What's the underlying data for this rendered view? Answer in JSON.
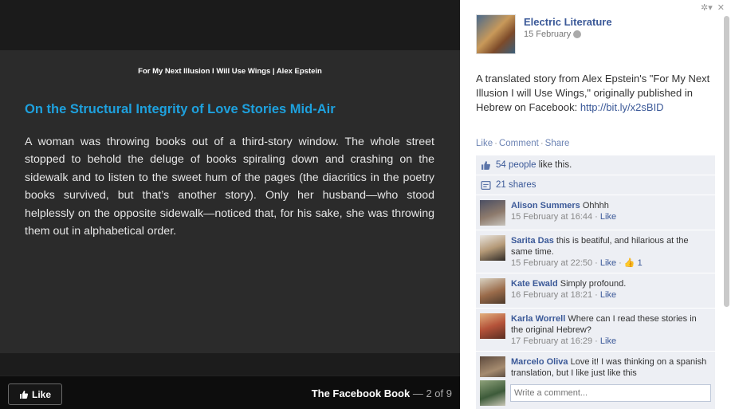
{
  "photo": {
    "header": "For My Next Illusion I Will Use Wings | Alex Epstein",
    "title": "On the Structural Integrity of Love Stories Mid-Air",
    "body": "A woman was throwing books out of a third-story window. The whole street stopped to behold the deluge of books spiraling down and crashing on the sidewalk and to listen to the sweet hum of the pages (the diacritics in the poetry books survived, but that’s another story). Only her husband—who stood helplessly on the opposite sidewalk—noticed that, for his sake, she was throwing them out in alphabetical order."
  },
  "bottom": {
    "like_label": "Like",
    "album_title": "The Facebook Book",
    "separator": "—",
    "position": "2 of 9"
  },
  "post": {
    "page_name": "Electric Literature",
    "date": "15 February",
    "text": "A translated story from Alex Epstein's \"For My Next Illusion I will Use Wings,\" originally published in Hebrew on Facebook:",
    "link": "http://bit.ly/x2sBID",
    "actions": [
      "Like",
      "Comment",
      "Share"
    ]
  },
  "feedback": {
    "likes_link": "54 people",
    "likes_suffix": " like this.",
    "shares": "21 shares"
  },
  "comments": [
    {
      "name": "Alison Summers",
      "text": "Ohhhh",
      "time": "15 February at 16:44",
      "like": "Like",
      "likes": ""
    },
    {
      "name": "Sarita Das",
      "text": "this is beatiful, and hilarious at the same time.",
      "time": "15 February at 22:50",
      "like": "Like",
      "likes": "1"
    },
    {
      "name": "Kate Ewald",
      "text": "Simply profound.",
      "time": "16 February at 18:21",
      "like": "Like",
      "likes": ""
    },
    {
      "name": "Karla Worrell",
      "text": "Where can I read these stories in the original Hebrew?",
      "time": "17 February at 16:29",
      "like": "Like",
      "likes": ""
    },
    {
      "name": "Marcelo Oliva",
      "text": "Love it! I was thinking on a spanish translation, but I like just like this",
      "time": "",
      "like": "",
      "likes": ""
    }
  ],
  "composer": {
    "placeholder": "Write a comment..."
  },
  "colors": {
    "title_accent": "#1ea1de",
    "facebook_blue": "#3b5998",
    "feedback_bg": "#edeff4"
  }
}
